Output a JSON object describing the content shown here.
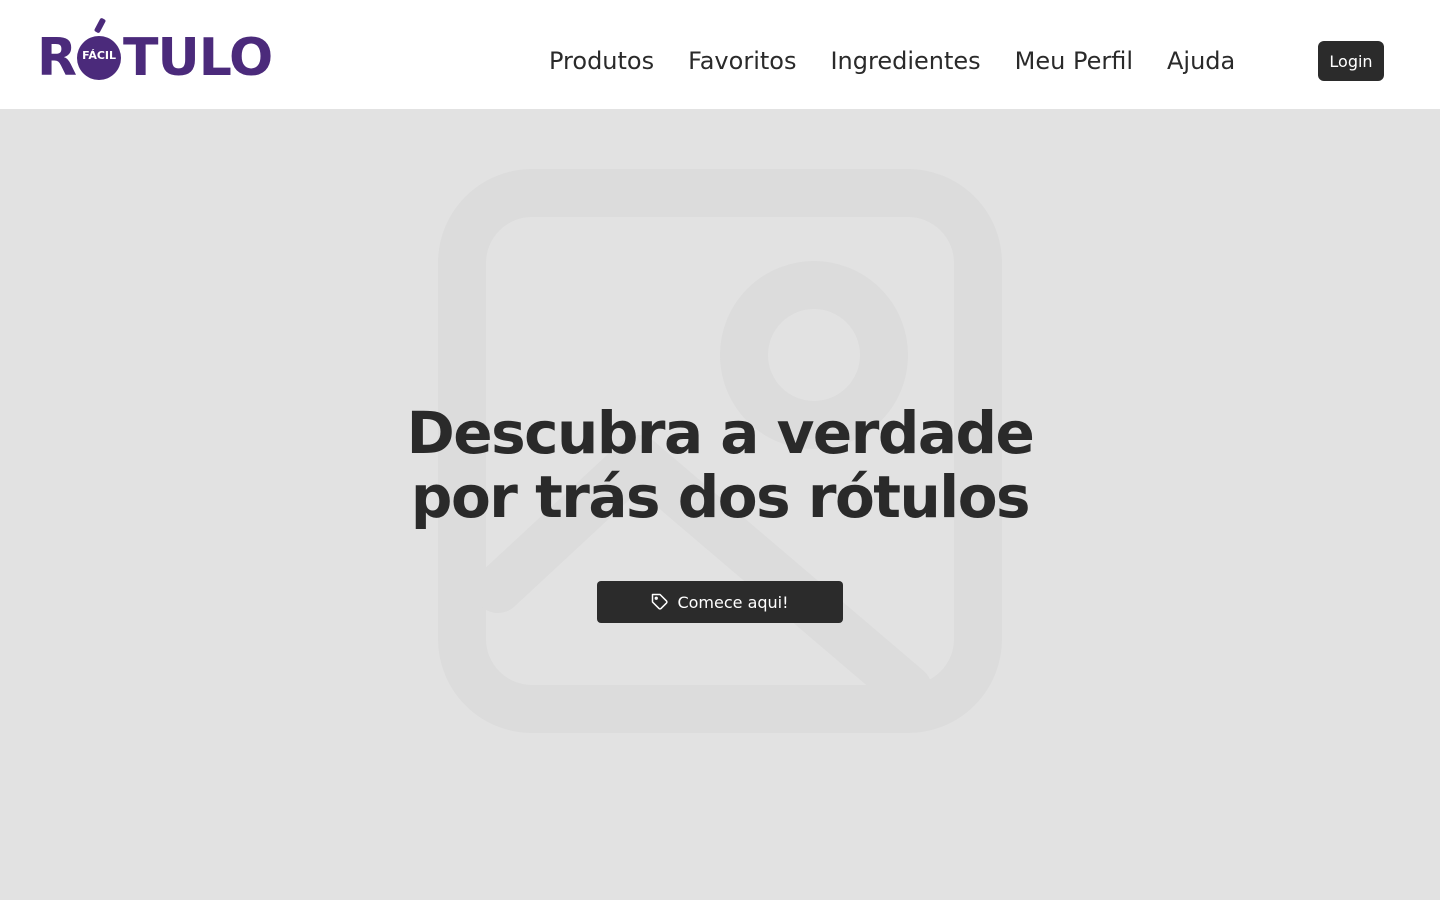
{
  "theme": {
    "brand_purple": "#4b2a7b",
    "dark_button": "#2b2b2b",
    "hero_background": "#e2e2e2",
    "placeholder_shape": "#dcdcdc",
    "text_dark": "#2a2a2a"
  },
  "logo": {
    "letter_r": "R",
    "inner_label": "FÁCIL",
    "letters_rest": "TULO",
    "icon": "rotulo-o-mark-icon"
  },
  "nav": {
    "items": [
      {
        "label": "Produtos"
      },
      {
        "label": "Favoritos"
      },
      {
        "label": "Ingredientes"
      },
      {
        "label": "Meu Perfil"
      },
      {
        "label": "Ajuda"
      }
    ],
    "login_label": "Login"
  },
  "hero": {
    "background_icon": "image-placeholder-icon",
    "title_line_1": "Descubra a verdade",
    "title_line_2": "por trás dos rótulos",
    "cta_label": "Comece aqui!",
    "cta_icon": "tag-icon"
  }
}
